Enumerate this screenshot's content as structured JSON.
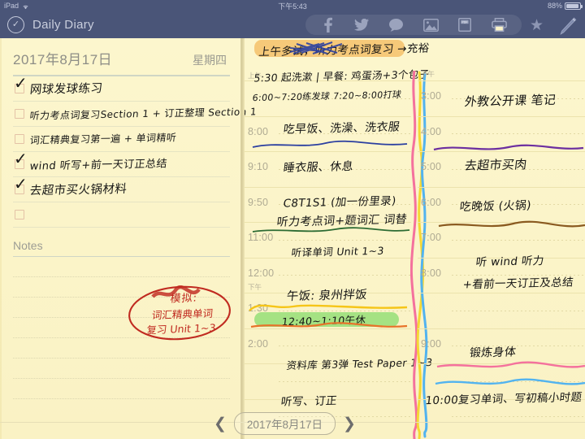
{
  "status_bar": {
    "device": "iPad",
    "wifi_icon": "wifi-icon",
    "time": "下午5:43",
    "battery_percent": "88%"
  },
  "toolbar": {
    "app_icon": "checkmark-circle-icon",
    "title": "Daily Diary",
    "share_icons": [
      {
        "name": "facebook-icon",
        "glyph": "f"
      },
      {
        "name": "twitter-icon",
        "glyph": "twitter"
      },
      {
        "name": "message-icon",
        "glyph": "message"
      },
      {
        "name": "photo-icon",
        "glyph": "photo"
      },
      {
        "name": "pdf-icon",
        "glyph": "PDF"
      },
      {
        "name": "print-icon",
        "glyph": "print"
      }
    ],
    "favorite_icon": "star-icon",
    "edit_icon": "pencil-icon"
  },
  "left_panel": {
    "date": "2017年8月17日",
    "weekday": "星期四",
    "todos": [
      {
        "checked": true,
        "text": "网球发球练习"
      },
      {
        "checked": false,
        "text": "听力考点词复习Section 1 + 订正整理 Section 1"
      },
      {
        "checked": false,
        "text": "词汇精典复习第一遍 + 单词精听"
      },
      {
        "checked": true,
        "text": "wind 听写+前一天订正总结"
      },
      {
        "checked": true,
        "text": "去超市买火锅材料"
      },
      {
        "checked": false,
        "text": ""
      }
    ],
    "notes_label": "Notes",
    "notes_annotation": {
      "line1": "模拟:",
      "line2": "词汇精典单词",
      "line3": "复习 Unit 1~3",
      "color": "#c02a20"
    }
  },
  "planner": {
    "am_label": "上午",
    "pm_label": "下午",
    "am_column": {
      "time_labels": [
        "8:00",
        "9:10",
        "9:50",
        "11:00",
        "12:00",
        "1:30",
        "2:00"
      ],
      "entries": [
        {
          "text": "上午多试，听力考点词复习 →充裕",
          "style": "header-highlight"
        },
        {
          "text": "5:30 起洗漱 | 早餐: 鸡蛋汤+3个包子"
        },
        {
          "text": "6:00~7:20练发球    7:20~8:00打球"
        },
        {
          "text": "吃早饭、洗澡、洗衣服"
        },
        {
          "text": "睡衣服、休息"
        },
        {
          "text": "C8T1S1 (加一份里录)"
        },
        {
          "text": "听力考点词+题词汇 词替"
        },
        {
          "text": "听译单词 Unit 1~3"
        },
        {
          "text": "午饭: 泉州拌饭"
        },
        {
          "text": "12:40~1:10午休",
          "style": "green-highlight"
        },
        {
          "text": "资料库 第3弹 Test Paper 1~3"
        },
        {
          "text": "听写、订正"
        }
      ]
    },
    "pm_column": {
      "time_labels": [
        "3:00",
        "4:00",
        "5:00",
        "6:00",
        "7:00",
        "8:00",
        "9:00"
      ],
      "entries": [
        {
          "text": "外教公开课 笔记"
        },
        {
          "text": "去超市买肉"
        },
        {
          "text": "吃晚饭 (火锅)"
        },
        {
          "text": "听 wind 听力"
        },
        {
          "text": "+看前一天订正及总结"
        },
        {
          "text": "锻炼身体"
        },
        {
          "text": "10:00复习单词、写初稿小时题"
        }
      ]
    }
  },
  "footer": {
    "prev_icon": "chevron-left-icon",
    "date": "2017年8月17日",
    "next_icon": "chevron-right-icon"
  },
  "colors": {
    "chrome": "#4a5578",
    "paper": "#fbf4c9",
    "rule": "#ece3ad",
    "time_text": "#b0ab93",
    "ink": "#141414",
    "red_ink": "#c02a20",
    "highlight_orange": "#f2a93c",
    "highlight_green": "#67d552",
    "wave_pink": "#f4719d",
    "wave_yellow": "#f5d834",
    "wave_blue": "#52b3ef"
  }
}
